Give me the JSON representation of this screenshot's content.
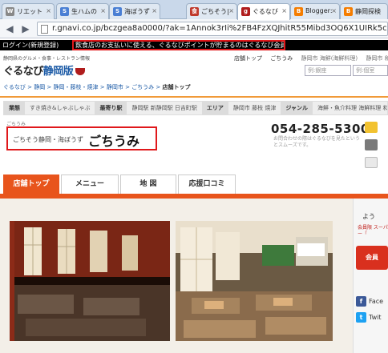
{
  "browser": {
    "tabs": [
      {
        "label": "リエット",
        "favicon": "W",
        "favicon_color": "#888888"
      },
      {
        "label": "生ハムの",
        "favicon": "S",
        "favicon_color": "#4a7fd4"
      },
      {
        "label": "海ぼうず",
        "favicon": "S",
        "favicon_color": "#4a7fd4"
      },
      {
        "label": "ごちそう|",
        "favicon": "食",
        "favicon_color": "#c0392b"
      },
      {
        "label": "ぐるなび",
        "favicon": "g",
        "favicon_color": "#b01d1d"
      },
      {
        "label": "Blogger:",
        "favicon": "B",
        "favicon_color": "#f57d00"
      },
      {
        "label": "静岡探検",
        "favicon": "B",
        "favicon_color": "#f57d00"
      }
    ],
    "tab_close": "×",
    "url": "r.gnavi.co.jp/bczgea8a0000/?ak=1Annok3rIi%2FB4FzXQJhitR55Mibd3OQ6X1UIRk5c"
  },
  "site": {
    "login_label": "ログイン(新規登録)",
    "promo_message": "飲食店のお支払いに使える、ぐるなびポイントが貯まるのはぐるなび会員だけ！",
    "tagline": "静岡県のグルメ・食事・レストラン情報",
    "logo_main": "ぐるなび",
    "logo_region": "静岡版",
    "top_links": [
      "店舗トップ",
      "ごちうみ",
      "静岡市 海鮮(海鮮料理)"
    ],
    "top_links_right": "静岡市 和食",
    "area_links": "",
    "search_placeholder_1": "例:銀座",
    "search_placeholder_2": "例:個室"
  },
  "breadcrumb": {
    "items": [
      "ぐるなび",
      "静岡",
      "静岡・藤枝・焼津",
      "静岡市",
      "ごちうみ"
    ],
    "current": "店舗トップ",
    "separator": " > "
  },
  "catbar": [
    {
      "label": "業態",
      "value": "すき焼き&しゃぶしゃぶ"
    },
    {
      "label": "最寄り駅",
      "value": "静岡駅 新静岡駅 日吉町駅"
    },
    {
      "label": "エリア",
      "value": "静岡市 藤枝 焼津"
    },
    {
      "label": "ジャンル",
      "value": "海鮮・魚介料理 海鮮料理 和食"
    }
  ],
  "shop": {
    "sub_label": "ごちうみ",
    "name_small": "ごちそう静岡・海ぼうず",
    "name_big": "ごちうみ",
    "phone": "054-285-5300",
    "phone_note": "お問合わせの際はぐるなびを見たというとスムーズです。"
  },
  "shop_tabs": [
    "店舗トップ",
    "メニュー",
    "地 図",
    "応援口コミ"
  ],
  "right_col": {
    "title": "よう",
    "note": "会員限\nスーパー「",
    "button_label": "会員",
    "social": [
      "Face",
      "Twit"
    ]
  },
  "colors": {
    "accent": "#e8541c",
    "highlight_border": "#e0181b",
    "brand_blue": "#1b5aa6",
    "brand_red": "#b01d1d"
  }
}
